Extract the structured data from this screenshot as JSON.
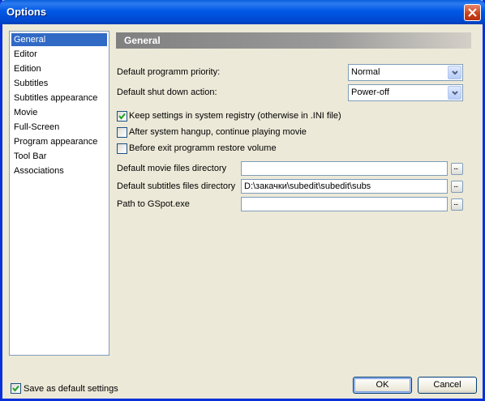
{
  "window": {
    "title": "Options",
    "close_icon": "close-icon"
  },
  "sidebar": {
    "items": [
      {
        "label": "General",
        "selected": true
      },
      {
        "label": "Editor",
        "selected": false
      },
      {
        "label": "Edition",
        "selected": false
      },
      {
        "label": "Subtitles",
        "selected": false
      },
      {
        "label": "Subtitles appearance",
        "selected": false
      },
      {
        "label": "Movie",
        "selected": false
      },
      {
        "label": "Full-Screen",
        "selected": false
      },
      {
        "label": "Program appearance",
        "selected": false
      },
      {
        "label": "Tool Bar",
        "selected": false
      },
      {
        "label": "Associations",
        "selected": false
      }
    ]
  },
  "general": {
    "header": "General",
    "priority": {
      "label": "Default programm priority:",
      "value": "Normal"
    },
    "shutdown": {
      "label": "Default shut down action:",
      "value": "Power-off"
    },
    "checkboxes": [
      {
        "label": "Keep settings in system registry (otherwise in .INI file)",
        "checked": true
      },
      {
        "label": "After system hangup, continue playing movie",
        "checked": false
      },
      {
        "label": "Before exit programm restore volume",
        "checked": false
      }
    ],
    "paths": [
      {
        "label": "Default movie files directory",
        "value": "",
        "browse": "..."
      },
      {
        "label": "Default subtitles files directory",
        "value": "D:\\закачки\\subedit\\subedit\\subs",
        "browse": "..."
      },
      {
        "label": "Path to GSpot.exe",
        "value": "",
        "browse": "..."
      }
    ]
  },
  "footer": {
    "save_default": {
      "label": "Save as default settings",
      "checked": true
    },
    "ok_label": "OK",
    "cancel_label": "Cancel"
  },
  "colors": {
    "titlebar": "#0054e3",
    "selection": "#316ac5",
    "face": "#ece9d8"
  }
}
